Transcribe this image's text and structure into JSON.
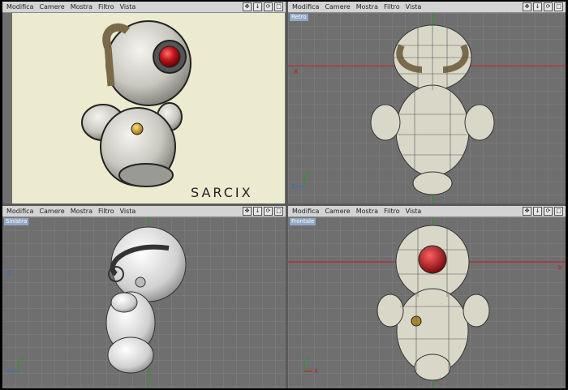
{
  "viewports": [
    {
      "id": "render",
      "menu": [
        "Modifica",
        "Camere",
        "Mostra",
        "Filtro",
        "Vista"
      ],
      "label": "",
      "logo": "SARCIX"
    },
    {
      "id": "top",
      "menu": [
        "Modifica",
        "Camere",
        "Mostra",
        "Filtro",
        "Vista"
      ],
      "label": "Retro",
      "axis_labels": {
        "x": "X",
        "y": "Y",
        "z": "Z"
      }
    },
    {
      "id": "left",
      "menu": [
        "Modifica",
        "Camere",
        "Mostra",
        "Filtro",
        "Vista"
      ],
      "label": "Sinistra",
      "axis_labels": {
        "x": "X",
        "y": "Y",
        "z": "Z"
      }
    },
    {
      "id": "front",
      "menu": [
        "Modifica",
        "Camere",
        "Mostra",
        "Filtro",
        "Vista"
      ],
      "label": "Frontale",
      "axis_labels": {
        "x": "X",
        "y": "Y",
        "z": "Z"
      }
    }
  ],
  "nav_icons": [
    "move-icon",
    "dolly-icon",
    "rotate-icon",
    "maximize-icon"
  ],
  "nav_glyphs": [
    "✥",
    "↓",
    "⟳",
    "□"
  ],
  "colors": {
    "viewport_bg": "#6f6f6f",
    "grid_line": "#808080",
    "axis_x": "#c01818",
    "axis_y": "#18a018",
    "eye_red": "#c0141c",
    "logo_red": "#c0141c"
  }
}
